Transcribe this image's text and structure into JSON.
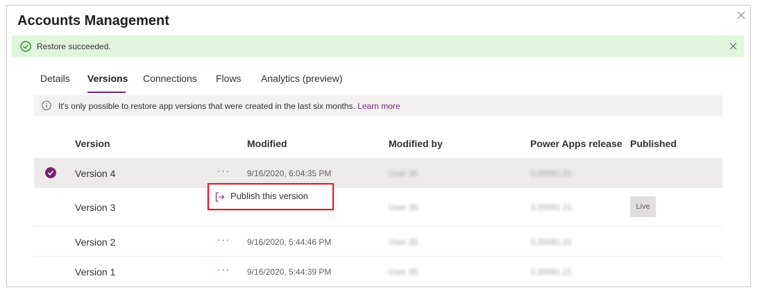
{
  "panel": {
    "title": "Accounts Management"
  },
  "banner": {
    "message": "Restore succeeded."
  },
  "tabs": [
    {
      "label": "Details"
    },
    {
      "label": "Versions"
    },
    {
      "label": "Connections"
    },
    {
      "label": "Flows"
    },
    {
      "label": "Analytics (preview)"
    }
  ],
  "active_tab": "Versions",
  "info": {
    "text": "It's only possible to restore app versions that were created in the last six months.",
    "link": "Learn more"
  },
  "table": {
    "headers": {
      "version": "Version",
      "modified": "Modified",
      "modified_by": "Modified by",
      "release": "Power Apps release",
      "published": "Published"
    },
    "rows": [
      {
        "version": "Version 4",
        "more": "···",
        "modified": "9/16/2020, 6:04:35 PM",
        "modified_by": "User 35",
        "release": "3.20091.21",
        "published": ""
      },
      {
        "version": "Version 3",
        "more": "···",
        "modified": "",
        "modified_by": "User 35",
        "release": "3.20091.21",
        "published": "Live"
      },
      {
        "version": "Version 2",
        "more": "···",
        "modified": "9/16/2020, 5:44:46 PM",
        "modified_by": "User 35",
        "release": "3.20091.21",
        "published": ""
      },
      {
        "version": "Version 1",
        "more": "···",
        "modified": "9/16/2020, 5:44:39 PM",
        "modified_by": "User 35",
        "release": "3.20091.21",
        "published": ""
      }
    ]
  },
  "context_menu": {
    "item": "Publish this version"
  },
  "colors": {
    "accent": "#742774",
    "success_bg": "#dff6dd",
    "highlight_border": "#e81123"
  }
}
